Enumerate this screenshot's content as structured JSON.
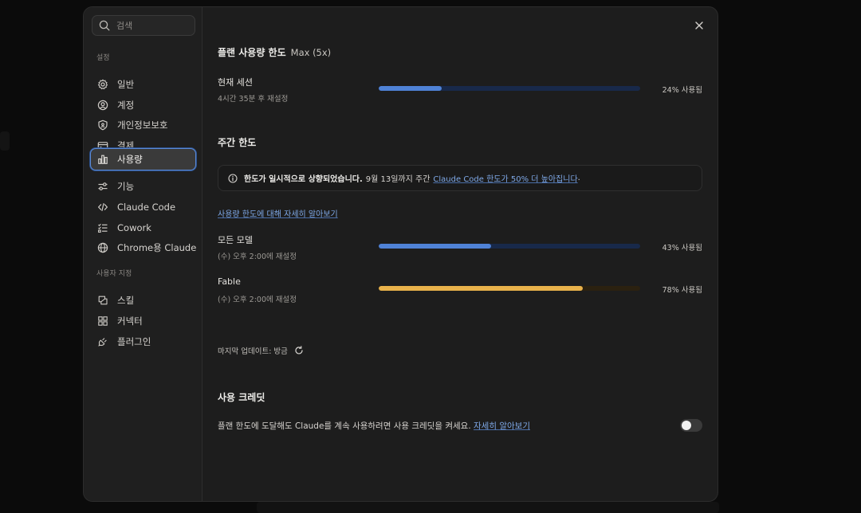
{
  "sidebar": {
    "search": {
      "placeholder": "검색"
    },
    "settings_label": "설정",
    "items": [
      {
        "label": "일반",
        "icon": "gear-icon"
      },
      {
        "label": "계정",
        "icon": "user-circle-icon"
      },
      {
        "label": "개인정보보호",
        "icon": "shield-icon"
      },
      {
        "label": "결제",
        "icon": "credit-card-icon"
      },
      {
        "label": "사용량",
        "icon": "bar-chart-icon"
      },
      {
        "label": "기능",
        "icon": "sliders-icon"
      },
      {
        "label": "Claude Code",
        "icon": "code-icon"
      },
      {
        "label": "Cowork",
        "icon": "checklist-icon"
      },
      {
        "label": "Chrome용 Claude",
        "icon": "globe-icon"
      }
    ],
    "custom_label": "사용자 지정",
    "custom_items": [
      {
        "label": "스킬",
        "icon": "skill-icon"
      },
      {
        "label": "커넥터",
        "icon": "connector-icon"
      },
      {
        "label": "플러그인",
        "icon": "plugin-icon"
      }
    ],
    "active_item": "사용량"
  },
  "plan_limits": {
    "title": "플랜 사용량 한도",
    "plan": "Max (5x)",
    "current_session": {
      "title": "현재 세션",
      "reset": "4시간 35분 후 재설정",
      "percent": 24,
      "percent_label": "24% 사용됨"
    }
  },
  "weekly": {
    "title": "주간 한도",
    "notice": {
      "bold": "한도가 일시적으로 상향되었습니다.",
      "normal": "9월 13일까지 주간",
      "link": "Claude Code 한도가 50% 더 높아집니다",
      "end": "."
    },
    "learn_more": "사용량 한도에 대해 자세히 알아보기",
    "rows": [
      {
        "title": "모든 모델",
        "reset": "(수) 오후 2:00에 재설정",
        "percent": 43,
        "percent_label": "43% 사용됨"
      },
      {
        "title": "Fable",
        "reset": "(수) 오후 2:00에 재설정",
        "percent": 78,
        "percent_label": "78% 사용됨"
      }
    ],
    "last_update": "마지막 업데이트: 방금"
  },
  "credits": {
    "title": "사용 크레딧",
    "text": "플랜 한도에 도달해도 Claude를 계속 사용하려면 사용 크레딧을 켜세요.",
    "link": "자세히 알아보기",
    "enabled": false
  },
  "colors": {
    "accent": "#4f82d6",
    "fable_bar": "#e9b24b",
    "link": "#7fa9e8"
  }
}
